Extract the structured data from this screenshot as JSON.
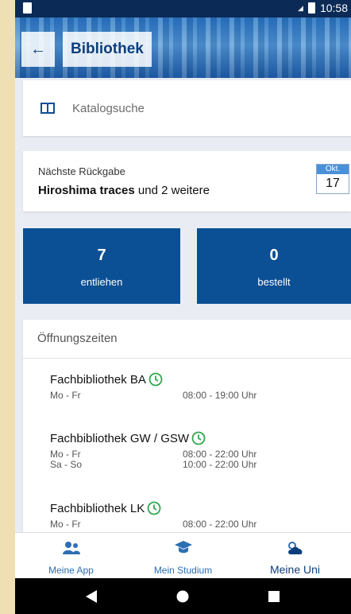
{
  "status": {
    "time": "10:58"
  },
  "appbar": {
    "back_icon": "arrow-left-icon",
    "title": "Bibliothek"
  },
  "search": {
    "icon": "book-open-icon",
    "label": "Katalogsuche"
  },
  "returns": {
    "label": "Nächste Rückgabe",
    "title_bold": "Hiroshima traces",
    "title_rest": " und 2 weitere",
    "month": "Okt.",
    "day": "17"
  },
  "tiles": [
    {
      "value": "7",
      "label": "entliehen"
    },
    {
      "value": "0",
      "label": "bestellt"
    }
  ],
  "hours": {
    "heading": "Öffnungszeiten",
    "libraries": [
      {
        "name": "Fachbibliothek BA",
        "rows": [
          {
            "days": "Mo - Fr",
            "time": "08:00 - 19:00 Uhr"
          }
        ]
      },
      {
        "name": "Fachbibliothek GW / GSW",
        "rows": [
          {
            "days": "Mo - Fr",
            "time": "08:00 - 22:00 Uhr"
          },
          {
            "days": "Sa - So",
            "time": "10:00 - 22:00 Uhr"
          }
        ]
      },
      {
        "name": "Fachbibliothek LK",
        "rows": [
          {
            "days": "Mo - Fr",
            "time": "08:00 - 22:00 Uhr"
          }
        ]
      }
    ]
  },
  "bottom_nav": [
    {
      "label": "Meine App",
      "icon": "people-icon"
    },
    {
      "label": "Mein Studium",
      "icon": "graduation-cap-icon"
    },
    {
      "label": "Meine Uni",
      "icon": "weather-icon"
    }
  ],
  "colors": {
    "primary": "#0b4f94",
    "accent": "#2d6fb3",
    "clock": "#2fa84f"
  }
}
